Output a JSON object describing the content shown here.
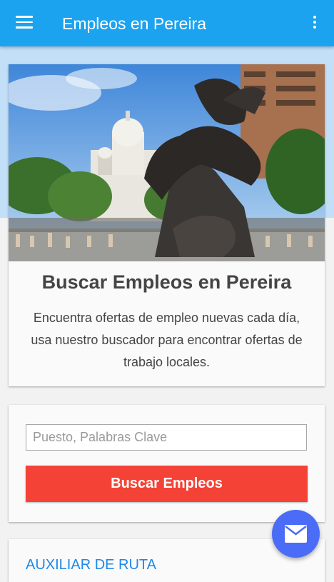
{
  "app_bar": {
    "title": "Empleos en Pereira",
    "menu_icon": "hamburger-menu-icon",
    "overflow_icon": "more-vert-icon",
    "color": "#1ba3ef"
  },
  "hero": {
    "title": "Buscar Empleos en Pereira",
    "description": "Encuentra ofertas de empleo nuevas cada día, usa nuestro buscador para encontrar ofertas de trabajo locales."
  },
  "search": {
    "placeholder": "Puesto, Palabras Clave",
    "value": "",
    "button_label": "Buscar Empleos",
    "button_color": "#f44336"
  },
  "jobs": [
    {
      "title": "AUXILIAR DE RUTA"
    }
  ],
  "fab": {
    "icon": "email-icon",
    "color": "#4a6cf7"
  }
}
